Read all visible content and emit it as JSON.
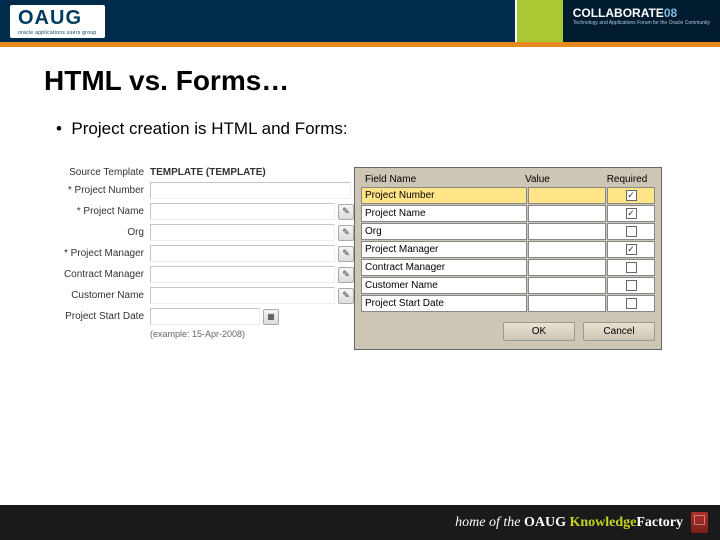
{
  "header": {
    "logo": "OAUG",
    "logo_sub": "oracle applications users group",
    "collab": "COLLABORATE",
    "collab_year": "08",
    "collab_sub": "Technology and Applications Forum for the Oracle Community"
  },
  "slide": {
    "title": "HTML vs. Forms…",
    "bullet": "Project creation is HTML and Forms:"
  },
  "html_form": {
    "source_template_label": "Source Template",
    "source_template_value": "TEMPLATE (TEMPLATE)",
    "rows": [
      {
        "label": "Project Number",
        "req": true,
        "pen": false
      },
      {
        "label": "Project Name",
        "req": true,
        "pen": true
      },
      {
        "label": "Org",
        "req": false,
        "pen": true
      },
      {
        "label": "Project Manager",
        "req": true,
        "pen": true
      },
      {
        "label": "Contract Manager",
        "req": false,
        "pen": true
      },
      {
        "label": "Customer Name",
        "req": false,
        "pen": true
      }
    ],
    "start_date_label": "Project Start Date",
    "example": "(example: 15-Apr-2008)"
  },
  "oracle_form": {
    "headers": {
      "field": "Field Name",
      "value": "Value",
      "required": "Required"
    },
    "rows": [
      {
        "field": "Project Number",
        "req": true
      },
      {
        "field": "Project Name",
        "req": true
      },
      {
        "field": "Org",
        "req": false
      },
      {
        "field": "Project Manager",
        "req": true
      },
      {
        "field": "Contract Manager",
        "req": false
      },
      {
        "field": "Customer Name",
        "req": false
      },
      {
        "field": "Project Start Date",
        "req": false
      }
    ],
    "ok": "OK",
    "cancel": "Cancel"
  },
  "footer": {
    "prefix": "home of the ",
    "oaug": "OAUG",
    "kf1": "Knowledge",
    "kf2": "Factory"
  }
}
